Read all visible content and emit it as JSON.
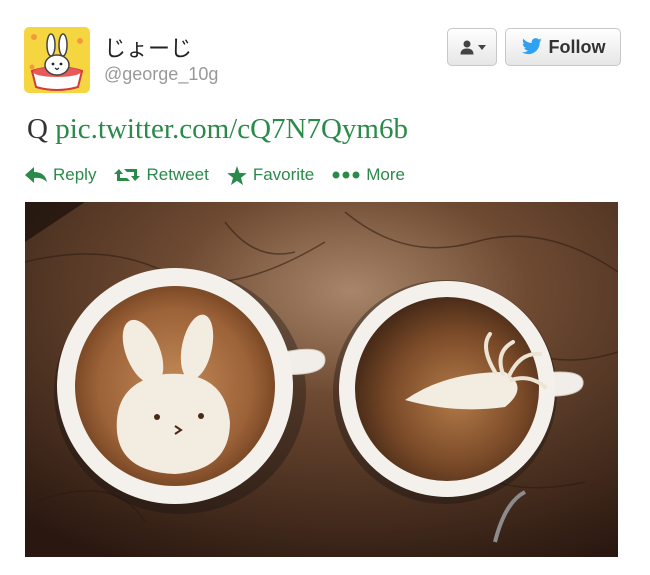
{
  "user": {
    "display_name": "じょーじ",
    "screen_name": "@george_10g"
  },
  "buttons": {
    "follow_label": "Follow"
  },
  "tweet": {
    "text_prefix": "Q",
    "link_text": "pic.twitter.com/cQ7N7Qym6b"
  },
  "actions": {
    "reply": "Reply",
    "retweet": "Retweet",
    "favorite": "Favorite",
    "more": "More"
  },
  "colors": {
    "action_green": "#2a8a4a",
    "twitter_blue": "#2ea1f2"
  }
}
